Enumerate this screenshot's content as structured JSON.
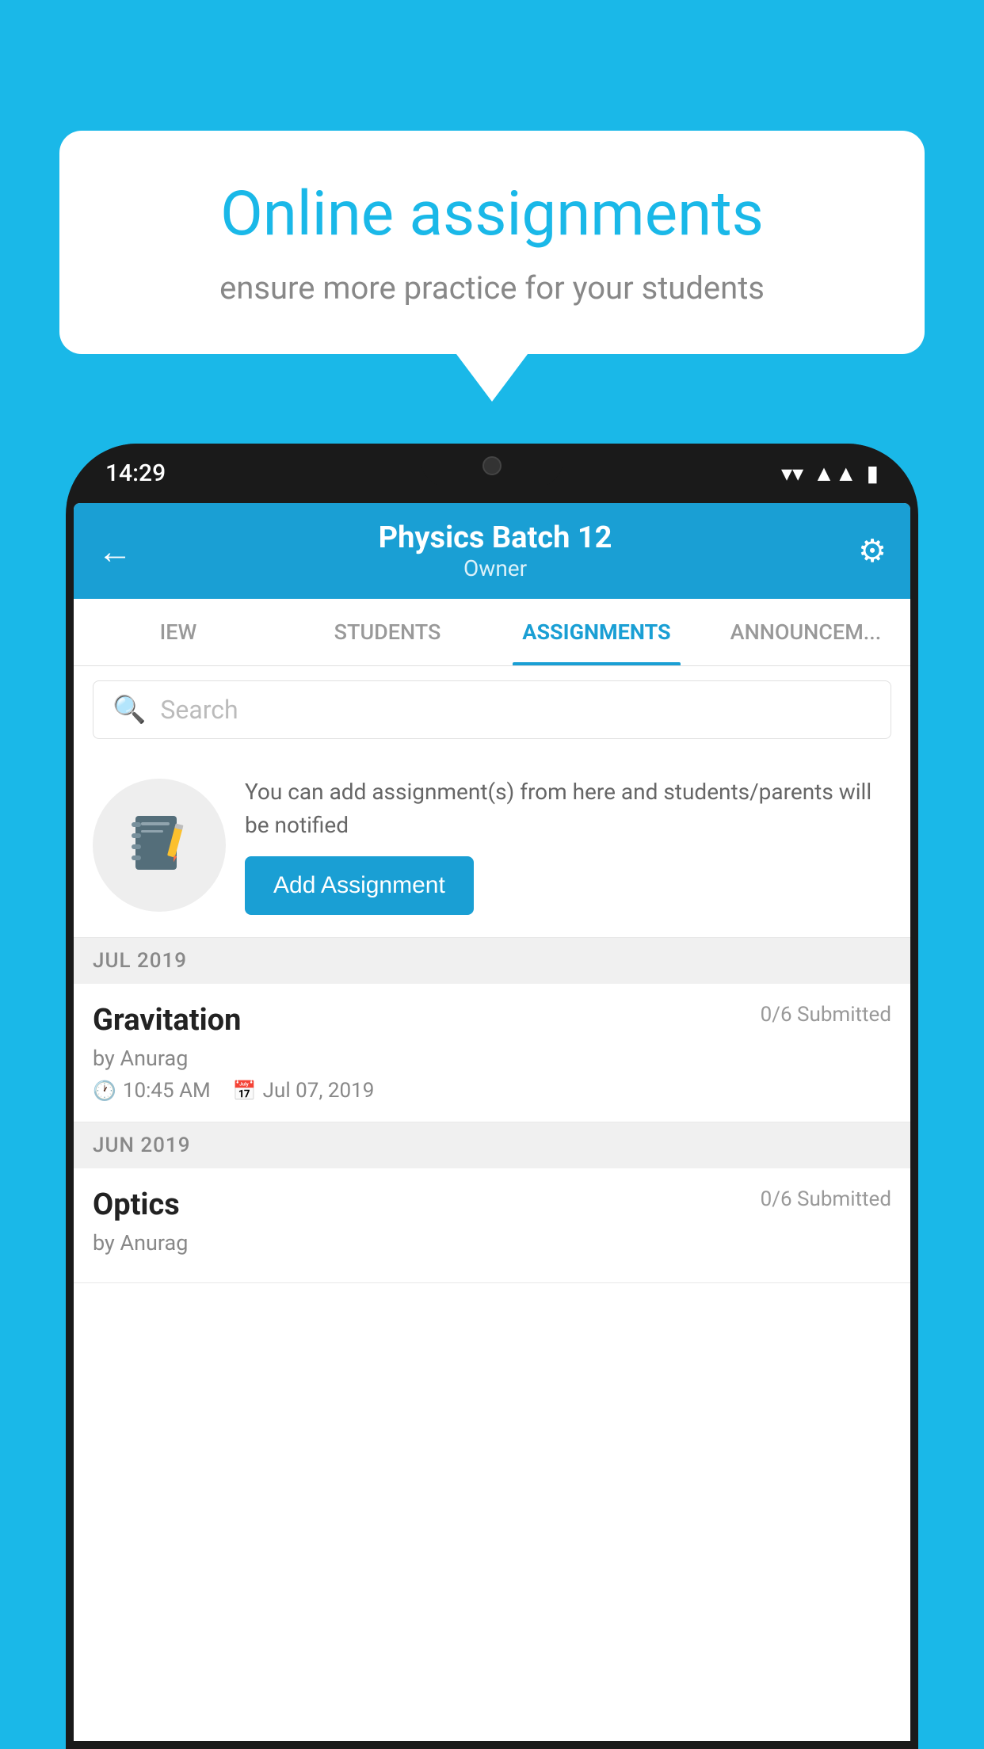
{
  "background_color": "#1ab8e8",
  "speech_bubble": {
    "title": "Online assignments",
    "subtitle": "ensure more practice for your students"
  },
  "phone": {
    "status_bar": {
      "time": "14:29",
      "icons": [
        "wifi",
        "signal",
        "battery"
      ]
    },
    "header": {
      "title": "Physics Batch 12",
      "subtitle": "Owner",
      "back_label": "←",
      "settings_label": "⚙"
    },
    "tabs": [
      {
        "label": "IEW",
        "active": false
      },
      {
        "label": "STUDENTS",
        "active": false
      },
      {
        "label": "ASSIGNMENTS",
        "active": true
      },
      {
        "label": "ANNOUNCEME",
        "active": false
      }
    ],
    "search": {
      "placeholder": "Search"
    },
    "promo": {
      "text": "You can add assignment(s) from here and students/parents will be notified",
      "button_label": "Add Assignment"
    },
    "sections": [
      {
        "header": "JUL 2019",
        "assignments": [
          {
            "title": "Gravitation",
            "submitted": "0/6 Submitted",
            "author": "by Anurag",
            "time": "10:45 AM",
            "date": "Jul 07, 2019"
          }
        ]
      },
      {
        "header": "JUN 2019",
        "assignments": [
          {
            "title": "Optics",
            "submitted": "0/6 Submitted",
            "author": "by Anurag",
            "time": "",
            "date": ""
          }
        ]
      }
    ]
  }
}
